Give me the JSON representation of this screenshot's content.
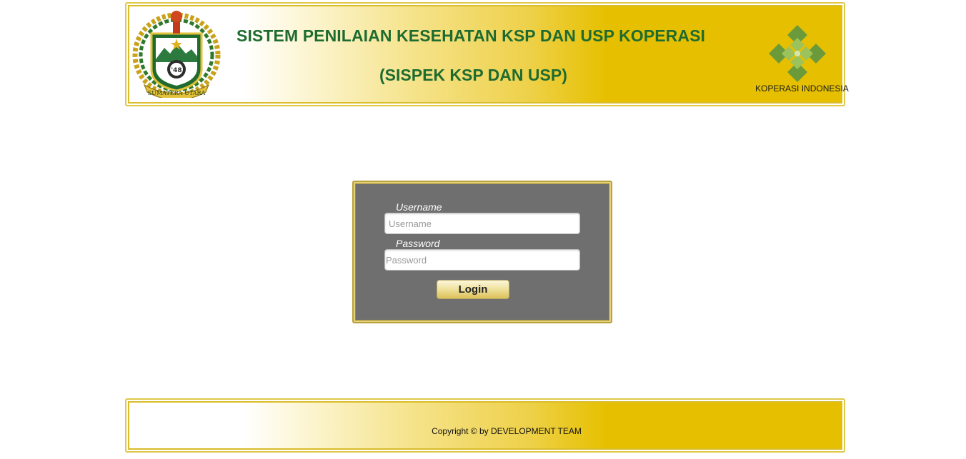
{
  "header": {
    "title_line1": "SISTEM PENILAIAN KESEHATAN KSP DAN USP KOPERASI",
    "title_line2": "(SISPEK KSP DAN USP)",
    "left_logo_icon": "sumatera-utara-emblem-icon",
    "left_logo_text": "SUMATERA UTARA",
    "right_logo_icon": "koperasi-indonesia-logo-icon",
    "right_logo_caption": "KOPERASI INDONESIA"
  },
  "login": {
    "username_label": "Username",
    "username_placeholder": "Username",
    "username_value": "",
    "password_label": "Password",
    "password_placeholder": "Password",
    "password_value": "",
    "login_button_label": "Login"
  },
  "footer": {
    "copyright": "Copyright © by DEVELOPMENT TEAM"
  },
  "colors": {
    "title_green": "#1e6b30",
    "banner_gold": "#e6c000",
    "login_panel_gray": "#6f6f6f",
    "frame_border": "#d9bd2a"
  }
}
